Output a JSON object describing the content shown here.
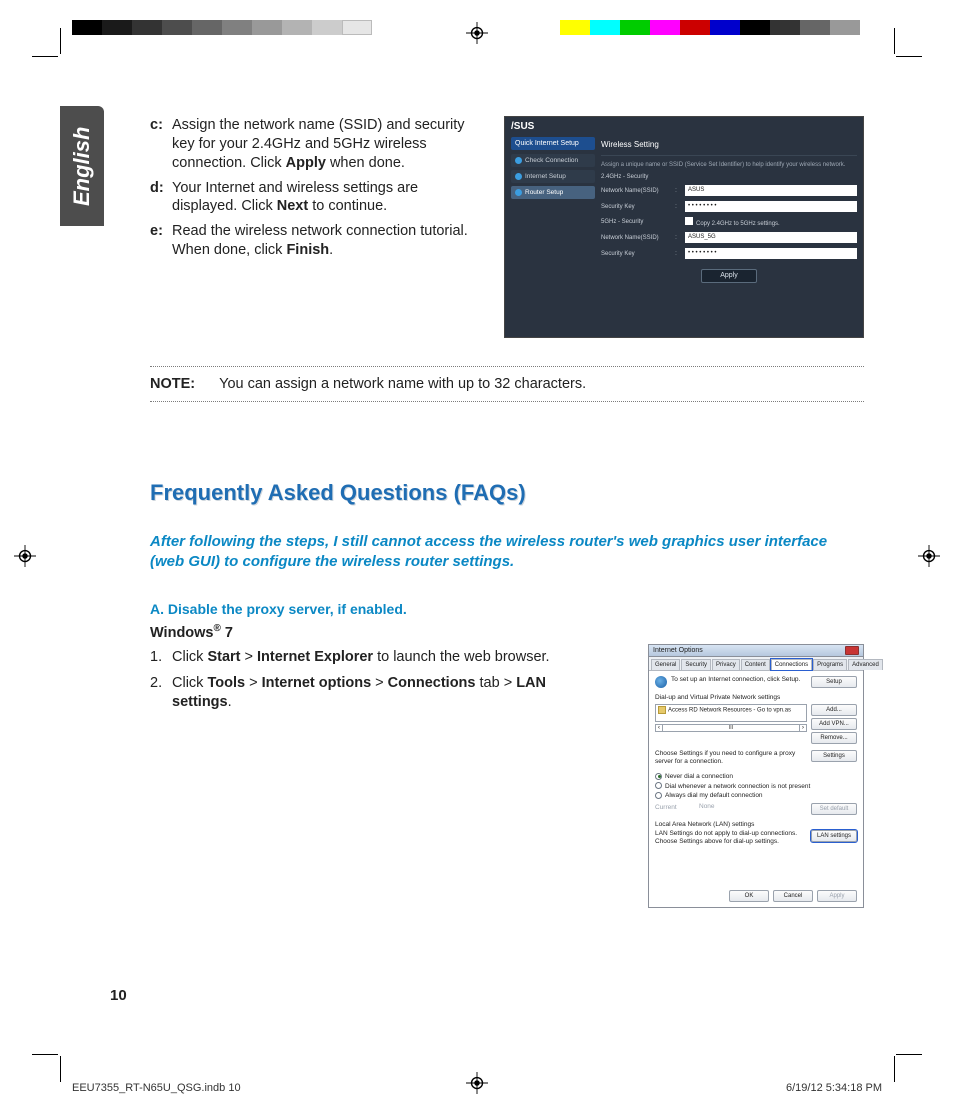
{
  "language_tab": "English",
  "steps": {
    "c": {
      "label": "c:",
      "pre": "Assign the network name (SSID) and security key for your 2.4GHz and 5GHz wireless connection. Click ",
      "bold": "Apply",
      "post": " when done."
    },
    "d": {
      "label": "d:",
      "pre": "Your Internet and wireless settings are displayed. Click ",
      "bold": "Next",
      "post": " to continue."
    },
    "e": {
      "label": "e:",
      "pre": "Read the wireless network connection tutorial. When done, click ",
      "bold": "Finish",
      "post": "."
    }
  },
  "router_shot": {
    "brand": "/SUS",
    "sidebar_header": "Quick Internet Setup",
    "sidebar_items": [
      "Check Connection",
      "Internet Setup",
      "Router Setup"
    ],
    "panel_title": "Wireless Setting",
    "panel_hint": "Assign a unique name or SSID (Service Set Identifier) to help identify your wireless network.",
    "sec1_label": "2.4GHz - Security",
    "row_ssid_label": "Network Name(SSID)",
    "row_ssid_val": "ASUS",
    "row_key_label": "Security Key",
    "row_key_val": "• • • • • • • •",
    "sec2_label": "5GHz - Security",
    "copy_label": "Copy 2.4GHz to 5GHz settings.",
    "row_ssid5_val": "ASUS_5G",
    "row_key5_val": "• • • • • • • •",
    "apply": "Apply"
  },
  "note": {
    "label": "NOTE:",
    "text": "You can assign a network name with up to 32 characters."
  },
  "faq_heading": "Frequently Asked Questions (FAQs)",
  "faq_q": "After following the steps, I still cannot access the wireless router's web graphics user interface (web GUI) to configure the wireless router settings.",
  "faq_a": "A.   Disable the proxy server, if enabled.",
  "os_line": {
    "pre": "Windows",
    "reg": "®",
    "post": " 7"
  },
  "num_steps": {
    "1": {
      "n": "1.",
      "p1": "Click ",
      "b1": "Start",
      "g1": " > ",
      "b2": "Internet Explorer",
      "p2": " to launch the web browser."
    },
    "2": {
      "n": "2.",
      "p1": "Click ",
      "b1": "Tools",
      "g1": " > ",
      "b2": "Internet options",
      "g2": " > ",
      "b3": "Connections",
      "p2": " tab > ",
      "b4": "LAN settings",
      "p3": "."
    }
  },
  "ie_shot": {
    "title": "Internet Options",
    "tabs": [
      "General",
      "Security",
      "Privacy",
      "Content",
      "Connections",
      "Programs",
      "Advanced"
    ],
    "setup_text": "To set up an Internet connection, click Setup.",
    "setup_btn": "Setup",
    "dialup_header": "Dial-up and Virtual Private Network settings",
    "dialup_item": "Access RD Network Resources - Go to vpn.as",
    "btn_add": "Add...",
    "btn_addvpn": "Add VPN...",
    "btn_remove": "Remove...",
    "choose_text": "Choose Settings if you need to configure a proxy server for a connection.",
    "btn_settings": "Settings",
    "radio1": "Never dial a connection",
    "radio2": "Dial whenever a network connection is not present",
    "radio3": "Always dial my default connection",
    "current_label": "Current",
    "current_val": "None",
    "btn_setdefault": "Set default",
    "lan_header": "Local Area Network (LAN) settings",
    "lan_text": "LAN Settings do not apply to dial-up connections. Choose Settings above for dial-up settings.",
    "btn_lan": "LAN settings",
    "btn_ok": "OK",
    "btn_cancel": "Cancel",
    "btn_apply": "Apply"
  },
  "page_number": "10",
  "slug_left": "EEU7355_RT-N65U_QSG.indb   10",
  "slug_right": "6/19/12   5:34:18 PM"
}
